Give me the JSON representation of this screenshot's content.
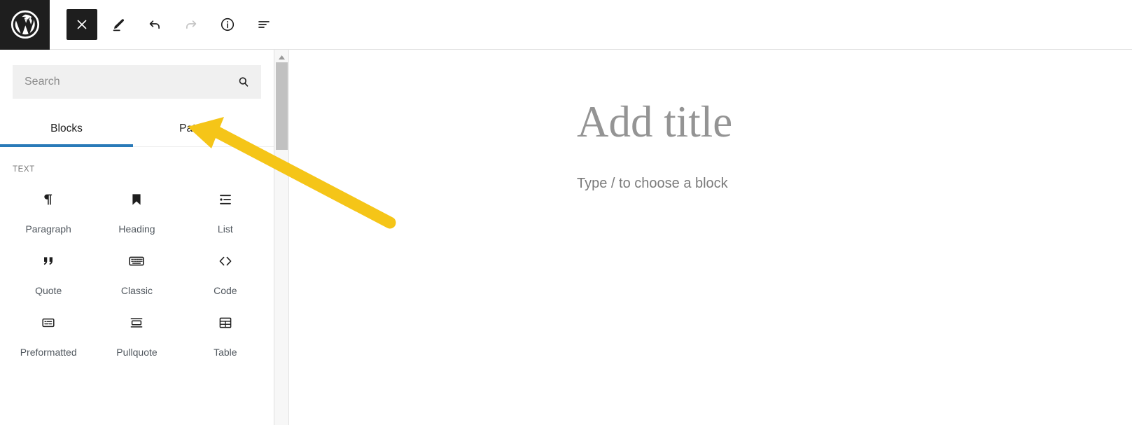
{
  "header": {
    "logo_icon": "wordpress-logo-icon",
    "tools": [
      {
        "name": "close-inserter-button",
        "icon": "close-x-icon",
        "state": "active",
        "label": "Close block inserter"
      },
      {
        "name": "edit-button",
        "icon": "pencil-icon",
        "state": "default",
        "label": "Edit"
      },
      {
        "name": "undo-button",
        "icon": "undo-arrow-icon",
        "state": "default",
        "label": "Undo"
      },
      {
        "name": "redo-button",
        "icon": "redo-arrow-icon",
        "state": "disabled",
        "label": "Redo"
      },
      {
        "name": "details-button",
        "icon": "info-circle-icon",
        "state": "default",
        "label": "Details"
      },
      {
        "name": "list-view-button",
        "icon": "list-view-icon",
        "state": "default",
        "label": "List view"
      }
    ]
  },
  "inserter": {
    "search": {
      "value": "",
      "placeholder": "Search",
      "icon": "search-magnifier-icon"
    },
    "tabs": [
      {
        "label": "Blocks",
        "active": true
      },
      {
        "label": "Patterns",
        "active": false
      }
    ],
    "category": "TEXT",
    "blocks": [
      {
        "label": "Paragraph",
        "icon": "paragraph-pilcrow-icon"
      },
      {
        "label": "Heading",
        "icon": "heading-bookmark-icon"
      },
      {
        "label": "List",
        "icon": "list-bullet-icon"
      },
      {
        "label": "Quote",
        "icon": "quote-marks-icon"
      },
      {
        "label": "Classic",
        "icon": "classic-keyboard-icon"
      },
      {
        "label": "Code",
        "icon": "code-brackets-icon"
      },
      {
        "label": "Preformatted",
        "icon": "preformatted-box-icon"
      },
      {
        "label": "Pullquote",
        "icon": "pullquote-icon"
      },
      {
        "label": "Table",
        "icon": "table-grid-icon"
      }
    ],
    "scrollbar": {
      "name": "inserter-scrollbar",
      "arrow_icon": "scroll-up-arrow-icon"
    }
  },
  "editor": {
    "title_placeholder": "Add title",
    "block_placeholder": "Type / to choose a block"
  },
  "annotation": {
    "arrow_color": "#f5c518",
    "target": "Patterns tab"
  },
  "colors": {
    "accent_blue": "#2a7ab8",
    "chrome_dark": "#1e1e1e",
    "field_gray": "#f0f0f0",
    "annotation_yellow": "#f5c518"
  }
}
